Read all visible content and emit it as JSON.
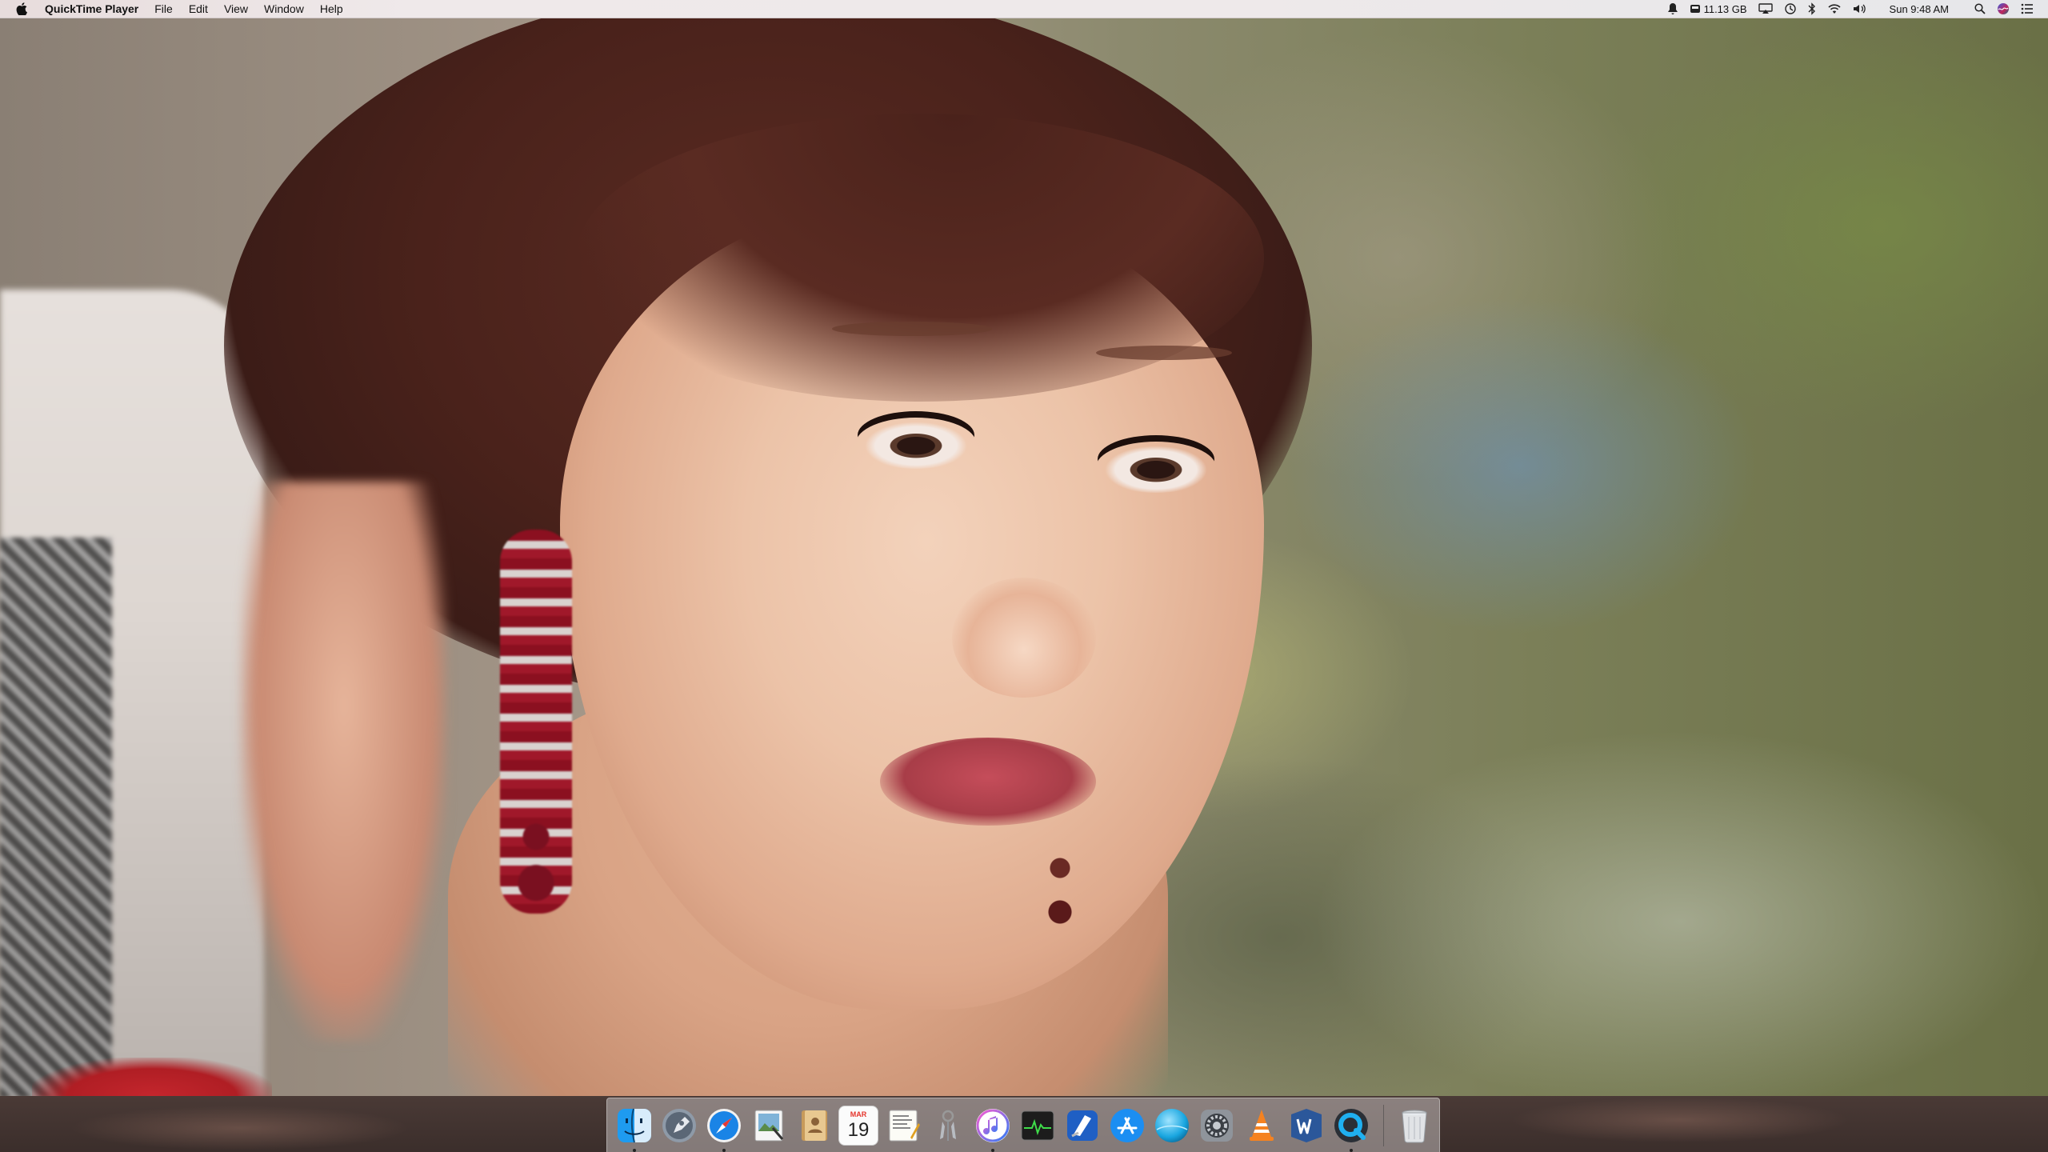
{
  "menubar": {
    "app_name": "QuickTime Player",
    "menus": [
      "File",
      "Edit",
      "View",
      "Window",
      "Help"
    ],
    "status": {
      "storage": "11.13 GB",
      "clock": "Sun 9:48 AM"
    },
    "status_icons": [
      "notification-alert-icon",
      "storage-icon",
      "airplay-icon",
      "time-machine-icon",
      "bluetooth-icon",
      "wifi-icon",
      "volume-icon",
      "spotlight-icon",
      "siri-icon",
      "notification-center-icon"
    ]
  },
  "desktop": {
    "wallpaper": "photo of a woman with red earrings"
  },
  "dock": {
    "apps": [
      {
        "name": "Finder",
        "icon": "finder-icon",
        "running": true
      },
      {
        "name": "Launchpad",
        "icon": "launchpad-icon",
        "running": false
      },
      {
        "name": "Safari",
        "icon": "safari-icon",
        "running": true
      },
      {
        "name": "Preview",
        "icon": "preview-icon",
        "running": false
      },
      {
        "name": "Contacts",
        "icon": "contacts-icon",
        "running": false
      },
      {
        "name": "Calendar",
        "icon": "calendar-icon",
        "running": false,
        "month": "MAR",
        "day": "19"
      },
      {
        "name": "TextEdit",
        "icon": "textedit-icon",
        "running": false
      },
      {
        "name": "Keychain",
        "icon": "keychain-icon",
        "running": false
      },
      {
        "name": "iTunes",
        "icon": "itunes-icon",
        "running": true
      },
      {
        "name": "Activity Monitor",
        "icon": "activity-monitor-icon",
        "running": false
      },
      {
        "name": "Xcode",
        "icon": "xcode-icon",
        "running": false
      },
      {
        "name": "App Store",
        "icon": "app-store-icon",
        "running": false
      },
      {
        "name": "Blue Sphere",
        "icon": "sphere-icon",
        "running": false
      },
      {
        "name": "System Preferences",
        "icon": "system-preferences-icon",
        "running": false
      },
      {
        "name": "VLC",
        "icon": "vlc-icon",
        "running": false
      },
      {
        "name": "Word",
        "icon": "word-icon",
        "running": false
      },
      {
        "name": "QuickTime Player",
        "icon": "quicktime-icon",
        "running": true
      }
    ],
    "trash": {
      "name": "Trash",
      "icon": "trash-icon"
    }
  },
  "colors": {
    "menubar_bg": "#ece7e8",
    "dock_bg": "#d9d4d4",
    "accent_blue": "#1a84e6"
  }
}
